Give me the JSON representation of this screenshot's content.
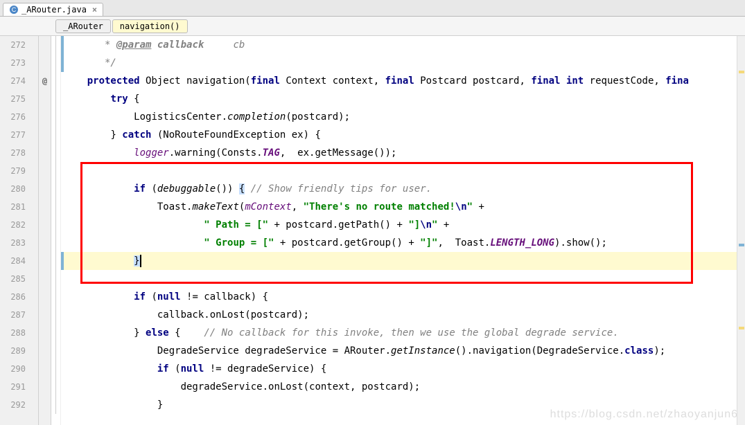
{
  "tab": {
    "filename": "_ARouter.java",
    "close": "×"
  },
  "breadcrumbs": {
    "class": "_ARouter",
    "method": "navigation()"
  },
  "gutter": {
    "start": 272,
    "end": 292,
    "override_at": 274,
    "override_glyph": "@"
  },
  "code": {
    "l272": {
      "prefix": " * ",
      "tag": "@param",
      "name": " callback",
      "desc": "     cb"
    },
    "l273": " */",
    "l274": {
      "t1": "protected",
      "t2": " Object navigation(",
      "t3": "final",
      "t4": " Context context, ",
      "t5": "final",
      "t6": " Postcard postcard, ",
      "t7": "final",
      "t8": " ",
      "t9": "int",
      "t10": " requestCode, ",
      "t11": "fina"
    },
    "l275": {
      "t1": "try",
      "t2": " {"
    },
    "l276": {
      "t1": "LogisticsCenter.",
      "t2": "completion",
      "t3": "(postcard);"
    },
    "l277": {
      "t1": "} ",
      "t2": "catch",
      "t3": " (NoRouteFoundException ex) {"
    },
    "l278": {
      "t1": "logger",
      "t2": ".warning(Consts.",
      "t3": "TAG",
      "t4": ",  ex.getMessage());"
    },
    "l280": {
      "t1": "if",
      "t2": " (",
      "t3": "debuggable",
      "t4": "()) ",
      "brace": "{",
      "cmt": " // Show friendly tips for user."
    },
    "l281": {
      "t1": "Toast.",
      "t2": "makeText",
      "t3": "(",
      "t4": "mContext",
      "t5": ", ",
      "s1": "\"There's no route matched!",
      "esc1": "\\n",
      "s1e": "\"",
      "t6": " +"
    },
    "l282": {
      "s1": "\" Path = [\"",
      "t1": " + postcard.getPath() + ",
      "s2": "\"]",
      "esc1": "\\n",
      "s2e": "\"",
      "t2": " +"
    },
    "l283": {
      "s1": "\" Group = [\"",
      "t1": " + postcard.getGroup() + ",
      "s2": "\"]\"",
      "t2": ",  Toast.",
      "c1": "LENGTH_LONG",
      "t3": ").show();"
    },
    "l284": {
      "brace": "}"
    },
    "l286": {
      "t1": "if",
      "t2": " (",
      "t3": "null",
      "t4": " != callback) {"
    },
    "l287": "callback.onLost(postcard);",
    "l288": {
      "t1": "} ",
      "t2": "else",
      "t3": " {    ",
      "cmt": "// No callback for this invoke, then we use the global degrade service."
    },
    "l289": {
      "t1": "DegradeService degradeService = ARouter.",
      "t2": "getInstance",
      "t3": "().navigation(DegradeService.",
      "t4": "class",
      "t5": ");"
    },
    "l290": {
      "t1": "if",
      "t2": " (",
      "t3": "null",
      "t4": " != degradeService) {"
    },
    "l291": "degradeService.onLost(context, postcard);",
    "l292": "}"
  },
  "watermark": "https://blog.csdn.net/zhaoyanjun6"
}
